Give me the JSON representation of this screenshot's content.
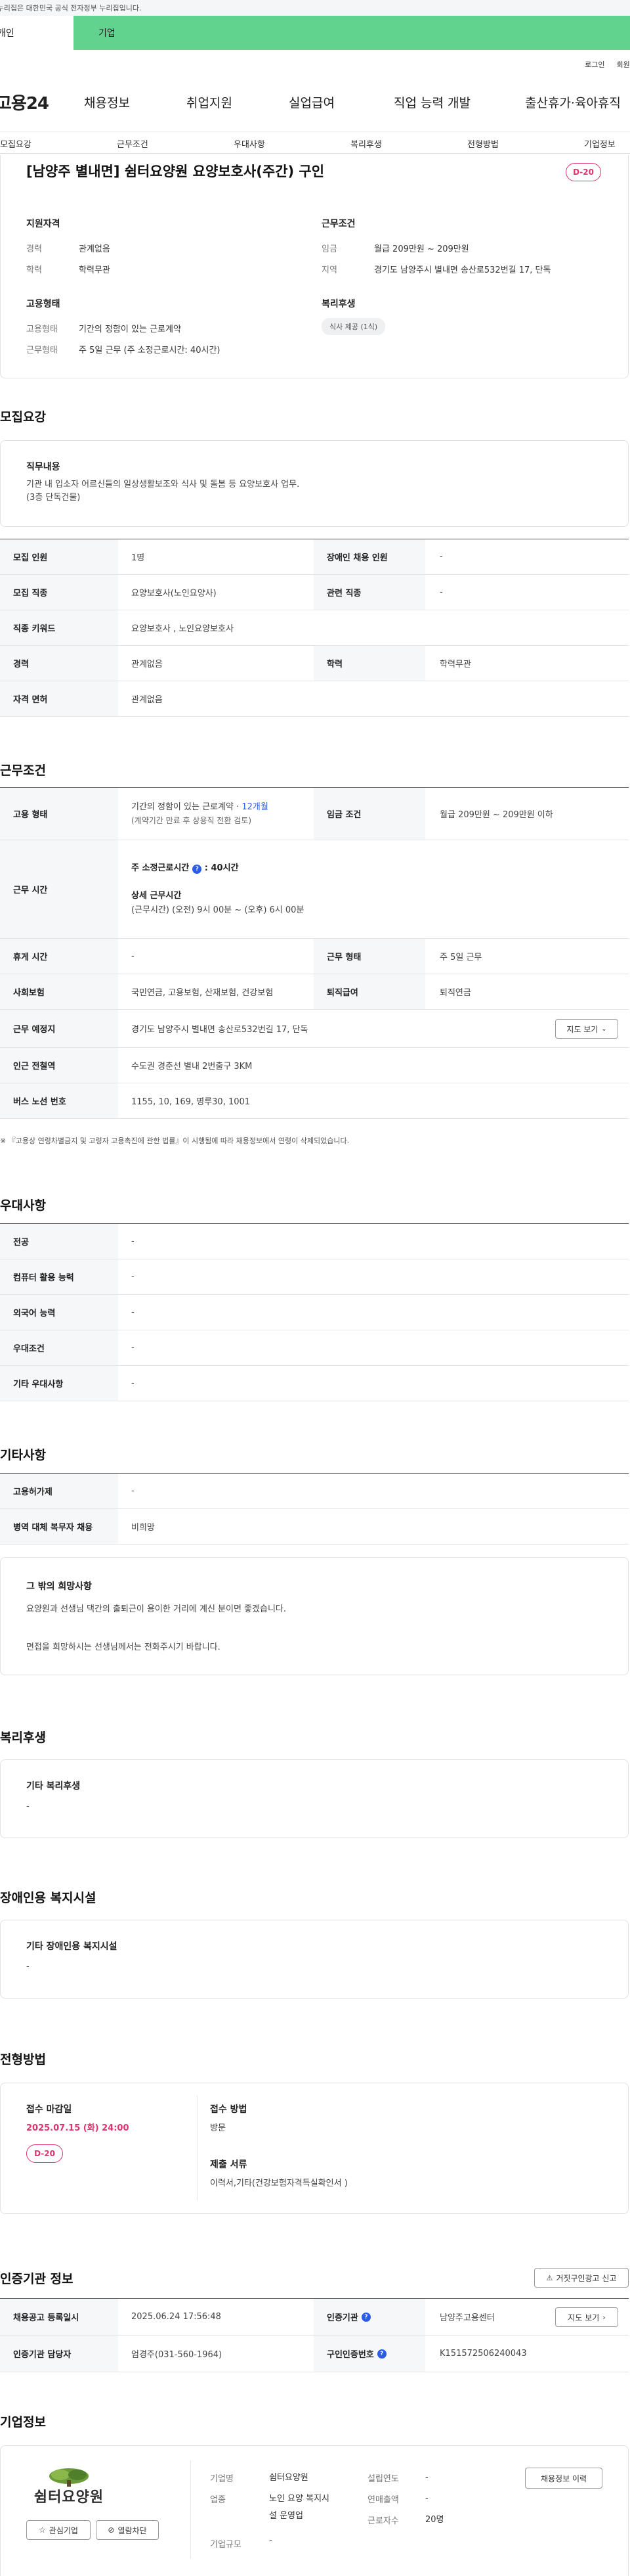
{
  "gov_banner": {
    "text": "이 누리집은 대한민국 공식 전자정부 누리집입니다."
  },
  "user_tabs": [
    {
      "label": "개인"
    },
    {
      "label": "기업"
    }
  ],
  "util_links": [
    {
      "label": "로그인"
    },
    {
      "label": "회원가입"
    }
  ],
  "gnb": {
    "logo": "고용24",
    "items": [
      {
        "label": "채용정보"
      },
      {
        "label": "취업지원"
      },
      {
        "label": "실업급여"
      },
      {
        "label": "직업 능력 개발"
      },
      {
        "label": "출산휴가·육아휴직"
      }
    ]
  },
  "anchor_nav": [
    {
      "label": "모집요강"
    },
    {
      "label": "근무조건"
    },
    {
      "label": "우대사항"
    },
    {
      "label": "복리후생"
    },
    {
      "label": "전형방법"
    },
    {
      "label": "기업정보"
    }
  ],
  "job": {
    "title": "[남양주 별내면] 쉼터요양원 요양보호사(주간) 구인",
    "dday": "D-20",
    "summary": {
      "qual_head": "지원자격",
      "career_label": "경력",
      "career_value": "관계없음",
      "edu_label": "학력",
      "edu_value": "학력무관",
      "emp_head": "고용형태",
      "emp_type_label": "고용형태",
      "emp_type_value": "기간의 정함이 있는 근로계약",
      "work_form_label": "근무형태",
      "work_form_value": "주 5일 근무 (주 소정근로시간: 40시간)",
      "cond_head": "근무조건",
      "wage_label": "임금",
      "wage_value": "월급 209만원 ~ 209만원",
      "region_label": "지역",
      "region_value": "경기도 남양주시 별내면 송산로532번길 17, 단독",
      "welfare_head": "복리후생",
      "welfare_chip": "식사 제공 (1식)"
    }
  },
  "recruit": {
    "title": "모집요강",
    "duty_title": "직무내용",
    "duty_line1": "기관 내 입소자 어르신들의 일상생활보조와 식사 및 돌봄 등 요양보호사 업무.",
    "duty_line2": "(3층 단독건물)",
    "rows": [
      {
        "th1": "모집 인원",
        "td1": "1명",
        "th2": "장애인 채용 인원",
        "td2": "-"
      },
      {
        "th1": "모집 직종",
        "td1": "요양보호사(노인요양사)",
        "th2": "관련 직종",
        "td2": "-"
      },
      {
        "th1": "직종 키워드",
        "td1": "요양보호사 , 노인요양보호사"
      },
      {
        "th1": "경력",
        "td1": "관계없음",
        "th2": "학력",
        "td2": "학력무관"
      },
      {
        "th1": "자격 면허",
        "td1": "관계없음"
      }
    ]
  },
  "work": {
    "title": "근무조건",
    "emp_label": "고용 형태",
    "emp_value_prefix": "기간의 정함이 있는 근로계약 · ",
    "emp_value_months": "12개월",
    "emp_value_note": "(계약기간 만료 후 상용직 전환 검토)",
    "wage_label": "임금 조건",
    "wage_value": "월급 209만원 ~ 209만원 이하",
    "time_label": "근무 시간",
    "weekly_label": "주 소정근로시간",
    "weekly_value": "40시간",
    "detail_label": "상세 근무시간",
    "detail_value": "(근무시간) (오전) 9시 00분 ~ (오후) 6시 00분",
    "rows": [
      {
        "th1": "휴게 시간",
        "td1": "-",
        "th2": "근무 형태",
        "td2": "주 5일 근무"
      },
      {
        "th1": "사회보험",
        "td1": "국민연금, 고용보험, 산재보험, 건강보험",
        "th2": "퇴직급여",
        "td2": "퇴직연금"
      },
      {
        "th1": "근무 예정지",
        "td1": "경기도 남양주시 별내면 송산로532번길 17, 단독",
        "button": "지도 보기"
      },
      {
        "th1": "인근 전철역",
        "td1": "수도권 경춘선 별내 2번출구 3KM"
      },
      {
        "th1": "버스 노선 번호",
        "td1": "1155, 10, 169, 명루30, 1001"
      }
    ],
    "note": "※ 『고용상 연령차별금지 및 고령자 고용촉진에 관한 법률』이 시행됨에 따라 채용정보에서 연령이 삭제되었습니다."
  },
  "prefer": {
    "title": "우대사항",
    "rows": [
      {
        "th": "전공",
        "td": "-"
      },
      {
        "th": "컴퓨터 활용 능력",
        "td": "-"
      },
      {
        "th": "외국어 능력",
        "td": "-"
      },
      {
        "th": "우대조건",
        "td": "-"
      },
      {
        "th": "기타 우대사항",
        "td": "-"
      }
    ]
  },
  "etc": {
    "title": "기타사항",
    "rows": [
      {
        "th": "고용허가제",
        "td": "-"
      },
      {
        "th": "병역 대체 복무자 채용",
        "td": "비희망"
      }
    ],
    "wish_title": "그 밖의 희망사항",
    "wish_line1": "요양원과 선생님 댁간의 출퇴근이 용이한 거리에 계신 분이면 좋겠습니다.",
    "wish_line2": "면접을 희망하시는 선생님께서는 전화주시기 바랍니다."
  },
  "welfare": {
    "title": "복리후생",
    "box_title": "기타 복리후생",
    "box_value": "-"
  },
  "disabled": {
    "title": "장애인용 복지시설",
    "box_title": "기타 장애인용 복지시설",
    "box_value": "-"
  },
  "screening": {
    "title": "전형방법",
    "deadline_label": "접수 마감일",
    "deadline_value": "2025.07.15 (화) 24:00",
    "dday": "D-20",
    "method_label": "접수 방법",
    "method_value": "방문",
    "docs_label": "제출 서류",
    "docs_value": "이력서,기타(건강보험자격득실확인서 )"
  },
  "cert": {
    "title": "인증기관 정보",
    "report_button": "거짓구인광고 신고",
    "reg_label": "채용공고 등록일시",
    "reg_value": "2025.06.24 17:56:48",
    "org_label": "인증기관",
    "org_value": "남양주고용센터",
    "map_button": "지도 보기",
    "manager_label": "인증기관 담당자",
    "manager_value": "엄경주(031-560-1964)",
    "cert_no_label": "구인인증번호",
    "cert_no_value": "K151572506240043"
  },
  "company": {
    "title": "기업정보",
    "logo_text": "쉼터요양원",
    "fav_button": "관심기업",
    "block_button": "열람차단",
    "name_label": "기업명",
    "name_value": "쉼터요양원",
    "industry_label": "업종",
    "industry_value_line1": "노인 요양 복지시",
    "industry_value_line2": "설 운영업",
    "size_label": "기업규모",
    "size_value": "-",
    "founded_label": "설립연도",
    "founded_value": "-",
    "sales_label": "연매출액",
    "sales_value": "-",
    "employees_label": "근로자수",
    "employees_value": "20명",
    "jobs_button": "채용정보 이력"
  }
}
